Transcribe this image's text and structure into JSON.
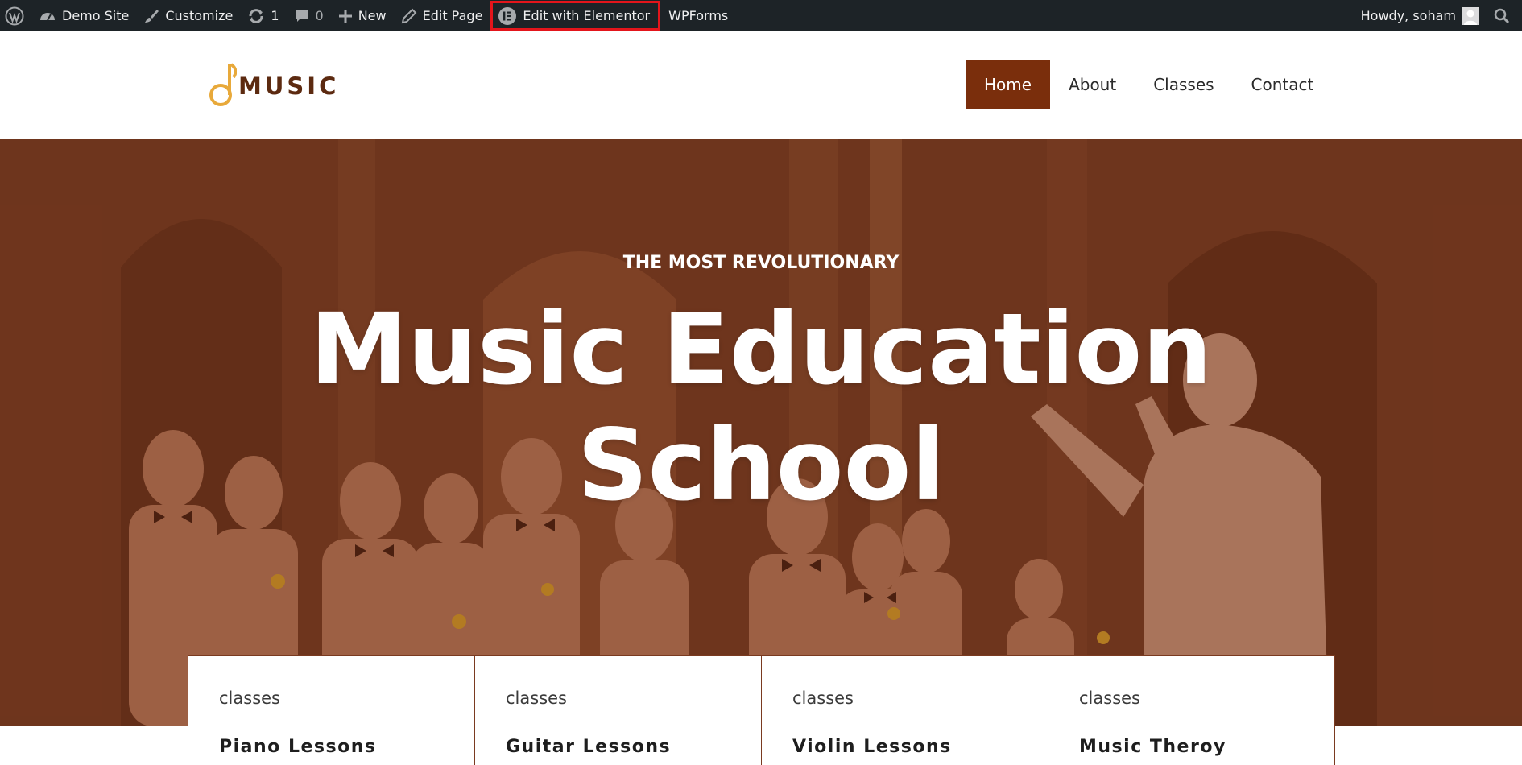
{
  "adminbar": {
    "wp_logo_icon": "wordpress-icon",
    "site_name": "Demo Site",
    "customize": "Customize",
    "updates_count": "1",
    "comments_count": "0",
    "new": "New",
    "edit_page": "Edit Page",
    "edit_elementor": "Edit with Elementor",
    "wpforms": "WPForms",
    "howdy": "Howdy, soham"
  },
  "header": {
    "logo_text": "MUSIC",
    "nav": [
      {
        "label": "Home",
        "active": true
      },
      {
        "label": "About",
        "active": false
      },
      {
        "label": "Classes",
        "active": false
      },
      {
        "label": "Contact",
        "active": false
      }
    ]
  },
  "hero": {
    "eyebrow": "THE MOST REVOLUTIONARY",
    "title_line1": "Music Education",
    "title_line2": "School"
  },
  "cards": [
    {
      "tag": "classes",
      "title": "Piano Lessons"
    },
    {
      "tag": "classes",
      "title": "Guitar Lessons"
    },
    {
      "tag": "classes",
      "title": "Violin Lessons"
    },
    {
      "tag": "classes",
      "title": "Music Theroy"
    }
  ],
  "colors": {
    "adminbar_bg": "#1d2327",
    "brand": "#7a2e0c",
    "highlight": "#e3151b",
    "logo_gold": "#e8a93a"
  }
}
